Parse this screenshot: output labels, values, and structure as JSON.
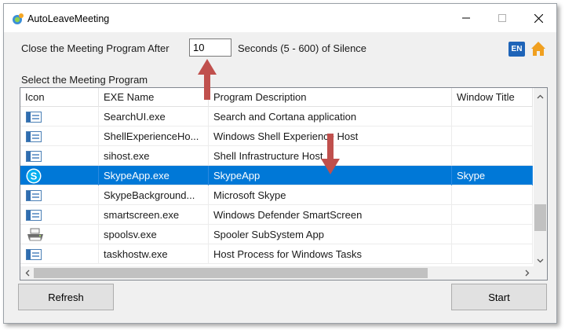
{
  "window": {
    "title": "AutoLeaveMeeting",
    "buttons": {
      "minimize": "–",
      "maximize": "☐",
      "close": "✕"
    }
  },
  "settings": {
    "close_label": "Close the Meeting Program After",
    "seconds_value": "10",
    "seconds_suffix": "Seconds (5 - 600) of Silence",
    "language_badge": "EN"
  },
  "program_list": {
    "label": "Select the Meeting Program",
    "columns": [
      "Icon",
      "EXE Name",
      "Program Description",
      "Window Title"
    ],
    "rows": [
      {
        "icon": "app-window-icon",
        "exe": "SearchUI.exe",
        "description": "Search and Cortana application",
        "window_title": ""
      },
      {
        "icon": "app-window-icon",
        "exe": "ShellExperienceHo...",
        "description": "Windows Shell Experience Host",
        "window_title": ""
      },
      {
        "icon": "app-window-icon",
        "exe": "sihost.exe",
        "description": "Shell Infrastructure Host",
        "window_title": ""
      },
      {
        "icon": "skype-icon",
        "exe": "SkypeApp.exe",
        "description": "SkypeApp",
        "window_title": "Skype",
        "selected": true
      },
      {
        "icon": "app-window-icon",
        "exe": "SkypeBackground...",
        "description": "Microsoft Skype",
        "window_title": ""
      },
      {
        "icon": "app-window-icon",
        "exe": "smartscreen.exe",
        "description": "Windows Defender SmartScreen",
        "window_title": ""
      },
      {
        "icon": "printer-icon",
        "exe": "spoolsv.exe",
        "description": "Spooler SubSystem App",
        "window_title": ""
      },
      {
        "icon": "app-window-icon",
        "exe": "taskhostw.exe",
        "description": "Host Process for Windows Tasks",
        "window_title": ""
      }
    ]
  },
  "actions": {
    "refresh_label": "Refresh",
    "start_label": "Start"
  },
  "colors": {
    "selection": "#0078d7",
    "annotation_arrow": "#c0504d",
    "home_icon": "#f0a020",
    "lang_badge": "#1e64b8"
  }
}
